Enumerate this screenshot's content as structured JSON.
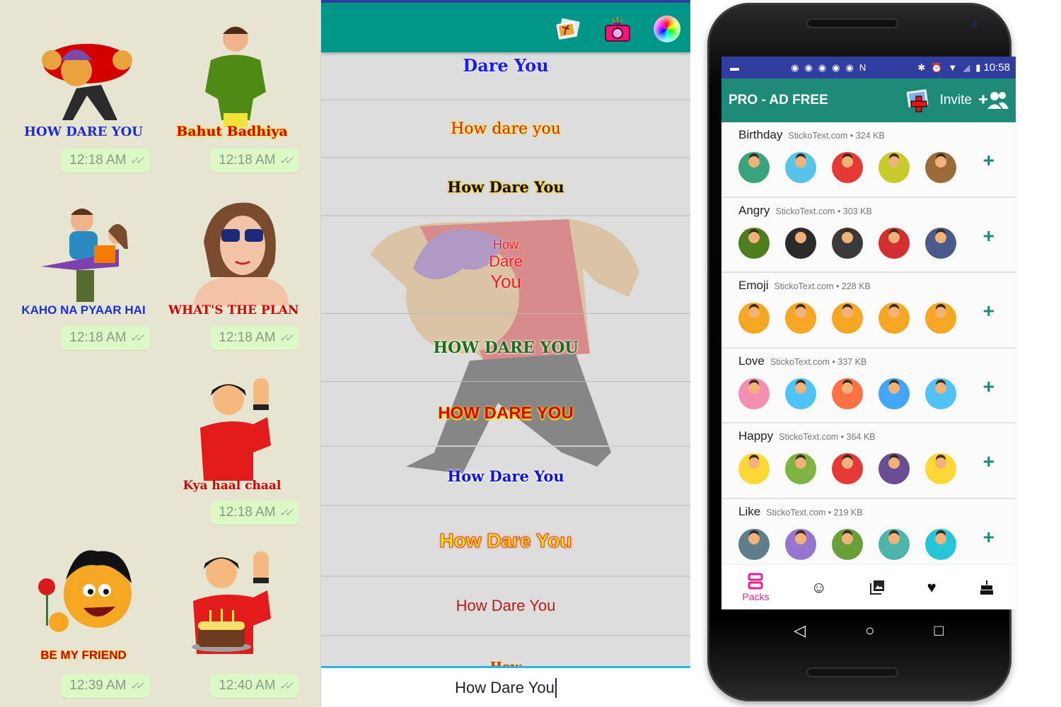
{
  "chat": {
    "messages": [
      {
        "caption": "HOW DARE YOU",
        "time": "12:18 AM",
        "receipt": "read-ticks"
      },
      {
        "caption": "Bahut Badhiya",
        "time": "12:18 AM",
        "receipt": "read-ticks"
      },
      {
        "caption": "KAHO NA PYAAR HAI",
        "time": "12:18 AM",
        "receipt": "read-ticks"
      },
      {
        "caption": "WHAT'S THE PLAN",
        "time": "12:18 AM",
        "receipt": "read-ticks"
      },
      {
        "caption": "Kya haal chaal",
        "time": "12:18 AM",
        "receipt": "read-ticks"
      },
      {
        "caption": "BE MY FRIEND",
        "time": "12:39 AM",
        "receipt": "read-ticks"
      },
      {
        "caption": "",
        "time": "12:40 AM",
        "receipt": "read-ticks"
      }
    ]
  },
  "editor": {
    "toolbar_icons": [
      "gallery-icon",
      "camera-icon",
      "color-wheel-icon"
    ],
    "preview_overlay": [
      "How",
      "Dare",
      "You"
    ],
    "styles": [
      {
        "text": "Dare You",
        "color": "#1a1aff"
      },
      {
        "text": "How dare you",
        "color": "#e02020"
      },
      {
        "text": "How Dare You",
        "color": "#111111"
      },
      {
        "text": "HOW DARE YOU",
        "color": "#1b6e1b"
      },
      {
        "text": "HOW DARE YOU",
        "color": "#e00000"
      },
      {
        "text": "How Dare You",
        "color": "#1010e0"
      },
      {
        "text": "How Dare You",
        "color": "#ffee00"
      },
      {
        "text": "How Dare You",
        "color": "#b71c1c"
      },
      {
        "text": "How",
        "color": "#c62828"
      }
    ],
    "input_value": "How Dare You"
  },
  "phone": {
    "status_bar": {
      "time": "10:58"
    },
    "app_title": "PRO - AD FREE",
    "invite_label": "Invite",
    "packs": [
      {
        "name": "Birthday",
        "meta": "StickoText.com • 324 KB",
        "thumb_colors": [
          "#3aa57a",
          "#58c3e8",
          "#e53935",
          "#c7cc2a",
          "#9c6b3a"
        ]
      },
      {
        "name": "Angry",
        "meta": "StickoText.com • 303 KB",
        "thumb_colors": [
          "#4e7d1e",
          "#2b2b2b",
          "#3a3a3a",
          "#d32f2f",
          "#4a5a8a"
        ]
      },
      {
        "name": "Emoji",
        "meta": "StickoText.com • 228 KB",
        "thumb_colors": [
          "#f5a623",
          "#f5a623",
          "#f5a623",
          "#f5a623",
          "#f5a623"
        ]
      },
      {
        "name": "Love",
        "meta": "StickoText.com • 337 KB",
        "thumb_colors": [
          "#f48fb1",
          "#4fc3f7",
          "#ff7043",
          "#42a5f5",
          "#4fc3f7"
        ]
      },
      {
        "name": "Happy",
        "meta": "StickoText.com • 364 KB",
        "thumb_colors": [
          "#fdd835",
          "#7cb342",
          "#e53935",
          "#6a4c93",
          "#fdd835"
        ]
      },
      {
        "name": "Like",
        "meta": "StickoText.com • 219 KB",
        "thumb_colors": [
          "#607d8b",
          "#9575cd",
          "#689f38",
          "#4db6ac",
          "#26c6da"
        ]
      }
    ],
    "bottom_nav": [
      {
        "label": "Packs",
        "icon": "packs-icon",
        "active": true
      },
      {
        "label": "",
        "icon": "smiley-icon"
      },
      {
        "label": "",
        "icon": "gallery-icon"
      },
      {
        "label": "",
        "icon": "heart-icon"
      },
      {
        "label": "",
        "icon": "cake-icon"
      }
    ],
    "system_nav": {
      "back": "◁",
      "home": "○",
      "recents": "□"
    },
    "accent": "#1e8a78",
    "active_tab_color": "#e91e8c"
  }
}
